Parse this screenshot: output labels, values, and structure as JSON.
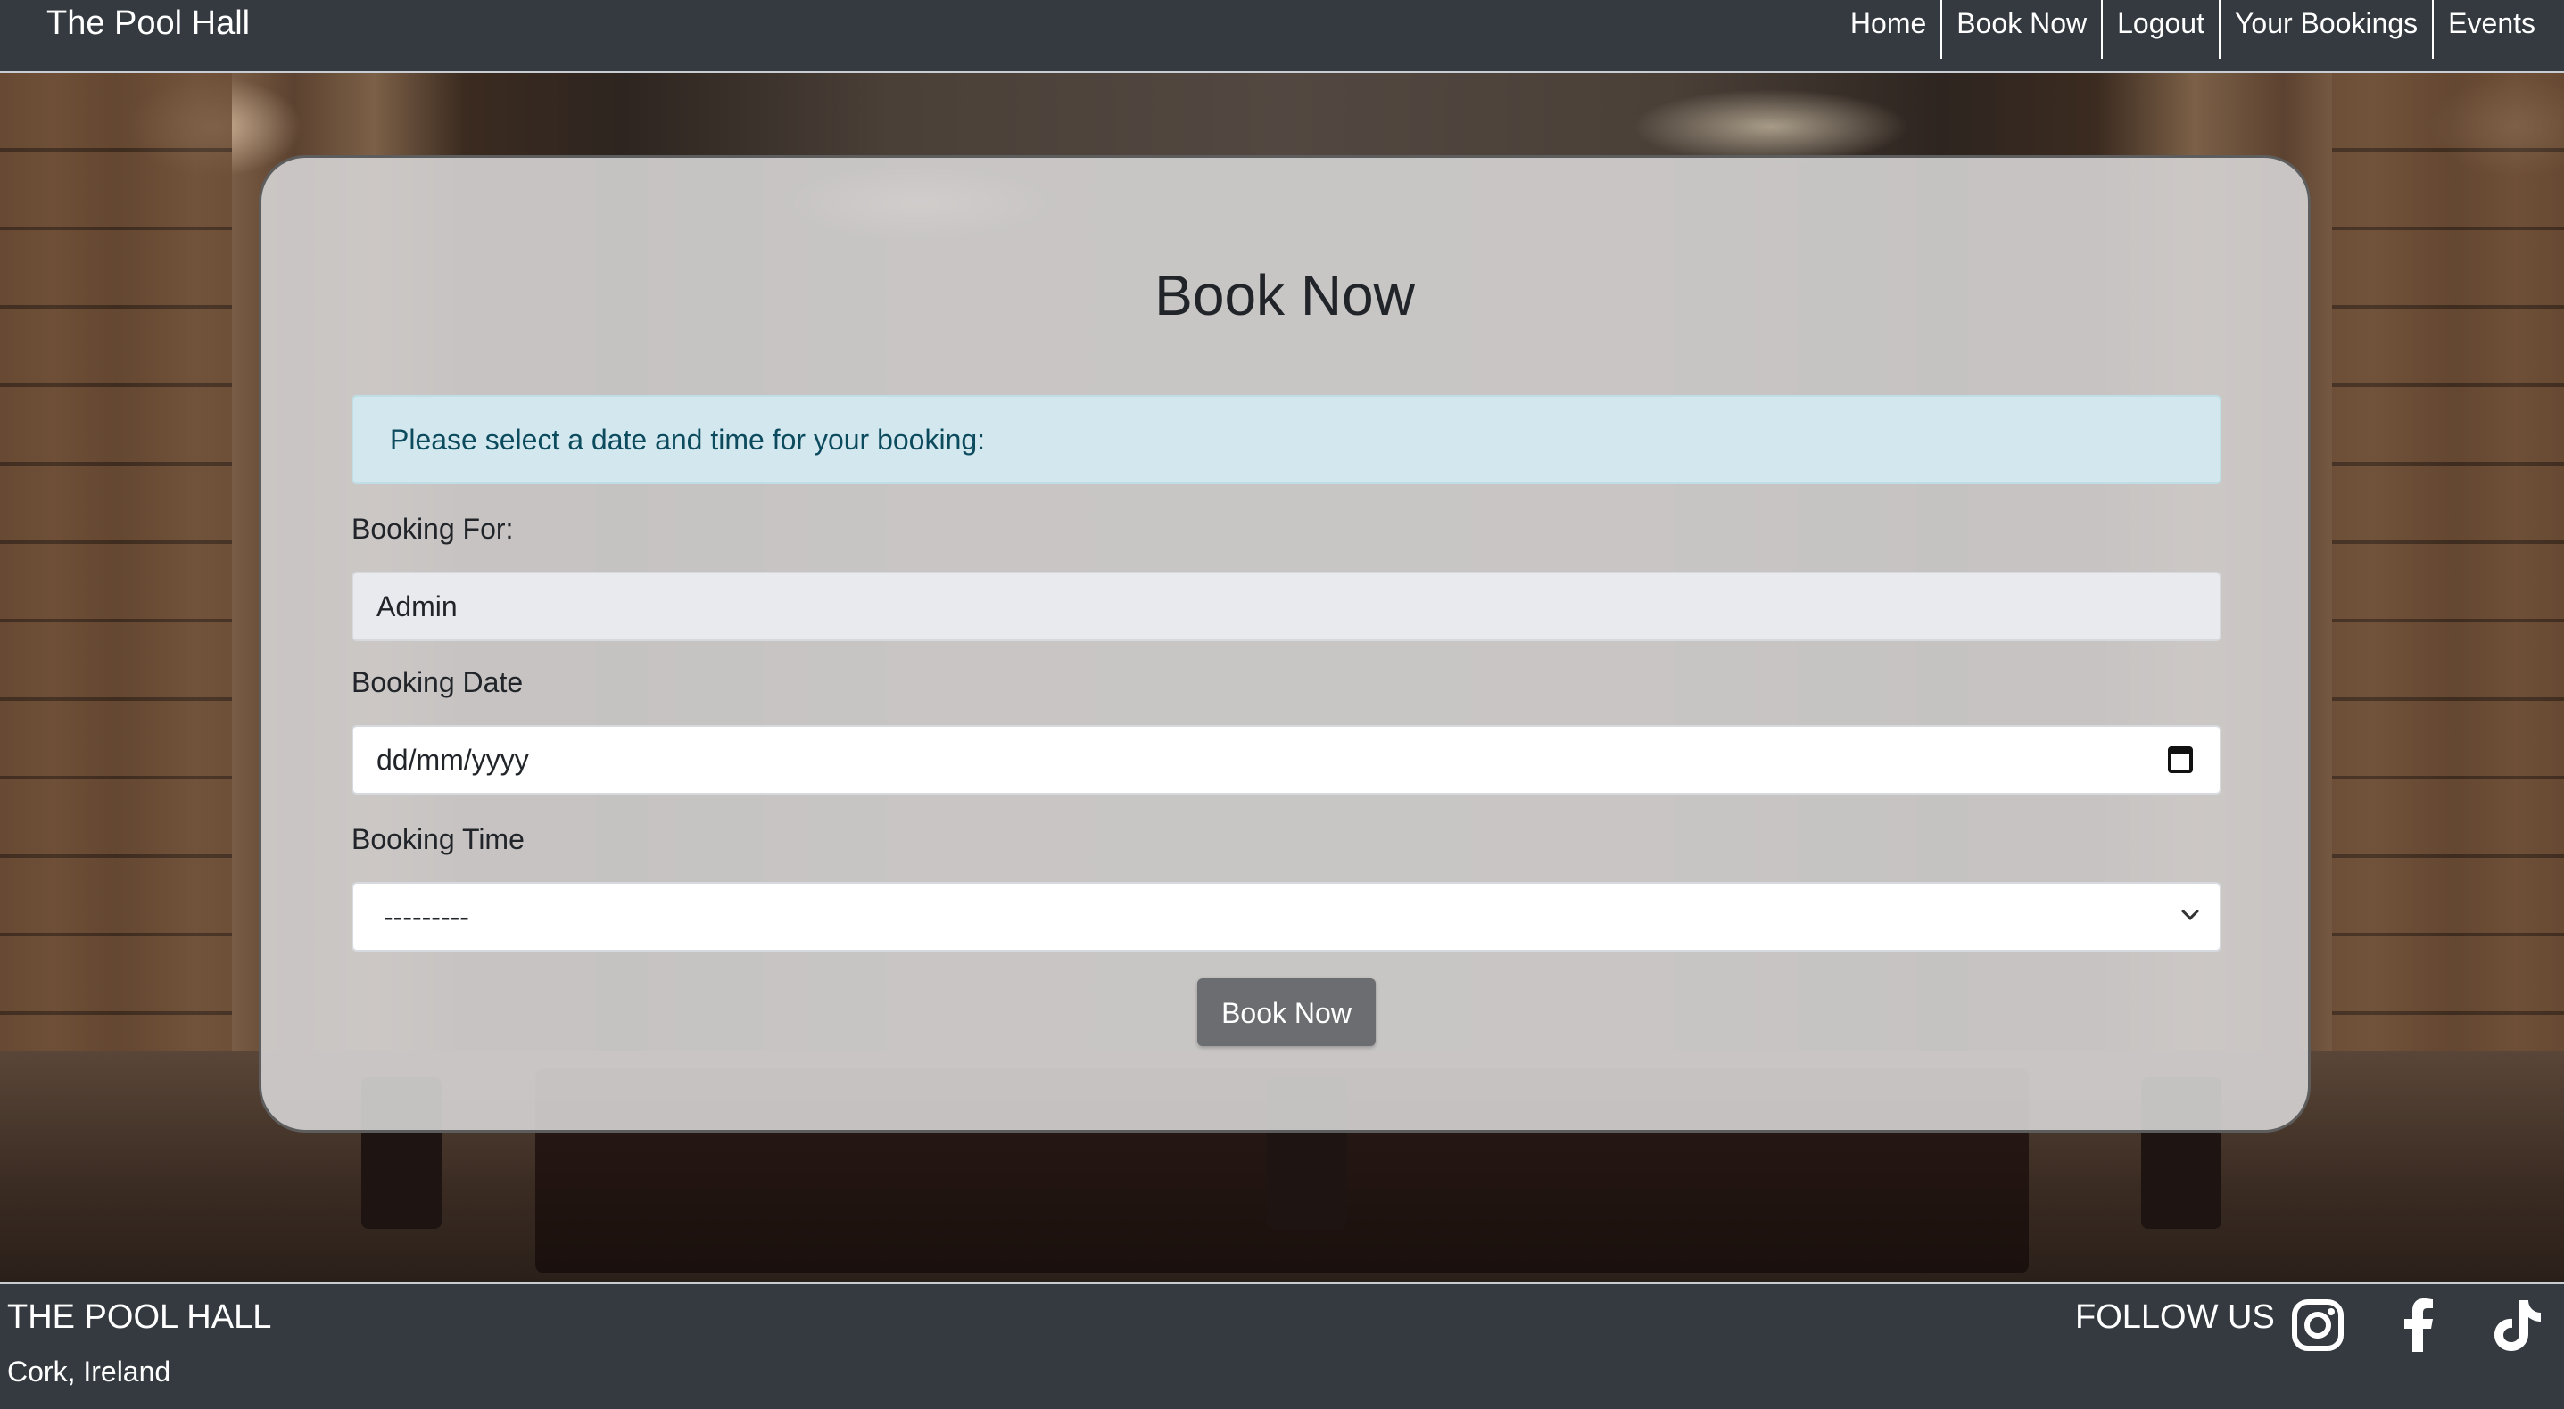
{
  "navbar": {
    "brand": "The Pool Hall",
    "links": [
      {
        "label": "Home"
      },
      {
        "label": "Book Now"
      },
      {
        "label": "Logout"
      },
      {
        "label": "Your Bookings"
      },
      {
        "label": "Events"
      }
    ]
  },
  "booking": {
    "title": "Book Now",
    "alert": "Please select a date and time for your booking:",
    "booking_for": {
      "label": "Booking For:",
      "value": "Admin"
    },
    "booking_date": {
      "label": "Booking Date",
      "placeholder": "dd/mm/yyyy",
      "icon": "calendar-icon"
    },
    "booking_time": {
      "label": "Booking Time",
      "selected": "---------",
      "icon": "chevron-down-icon"
    },
    "submit_label": "Book Now"
  },
  "footer": {
    "title": "THE POOL HALL",
    "address": "Cork, Ireland",
    "follow_label": "FOLLOW US",
    "socials": [
      "instagram-icon",
      "facebook-icon",
      "tiktok-icon"
    ]
  },
  "colors": {
    "navbar_bg": "#343a40",
    "card_bg": "#d2d0d0",
    "alert_bg": "#d2e8ee",
    "alert_text": "#0c4b5e",
    "button_bg": "#6c6d70"
  }
}
